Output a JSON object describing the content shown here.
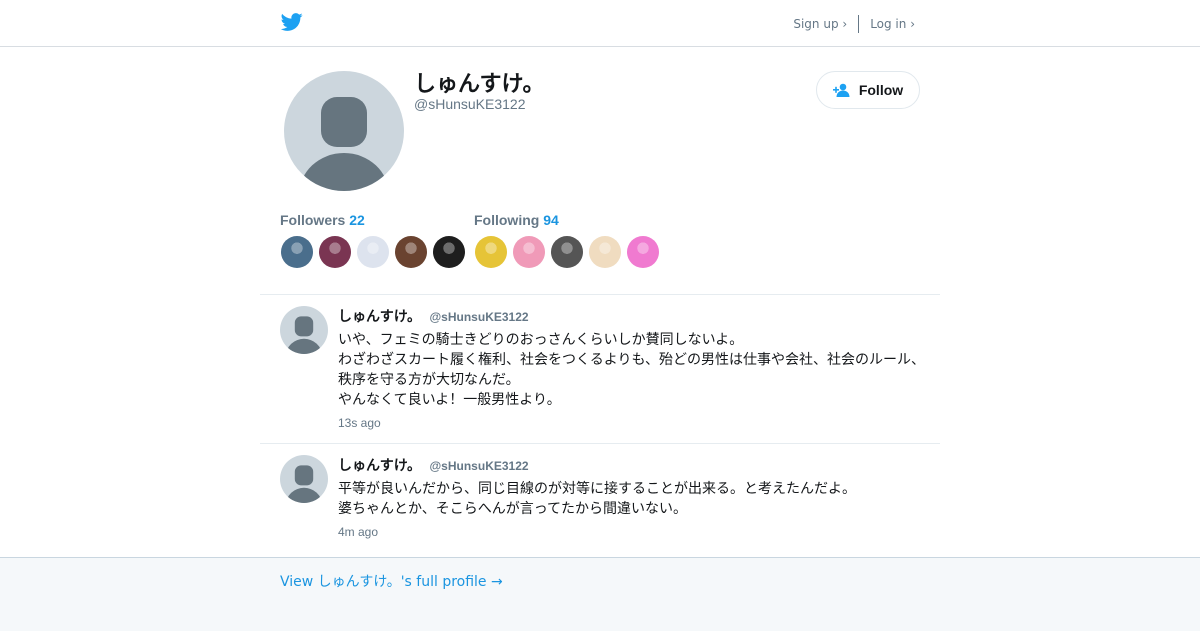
{
  "nav": {
    "signup_label": "Sign up ›",
    "login_label": "Log in ›"
  },
  "profile": {
    "name": "しゅんすけ。",
    "handle": "@sHunsuKE3122",
    "follow_label": "Follow"
  },
  "stats": {
    "followers_label": "Followers",
    "followers_count": "22",
    "following_label": "Following",
    "following_count": "94"
  },
  "followers_avatars": [
    "#4a6e8c",
    "#7a3552",
    "#dde3ee",
    "#6a4330",
    "#1e1e1e"
  ],
  "following_avatars": [
    "#e6c437",
    "#f09ab8",
    "#555555",
    "#f0dcc0",
    "#f07ad0"
  ],
  "tweets": [
    {
      "name": "しゅんすけ。",
      "handle": "@sHunsuKE3122",
      "lines": [
        "いや、フェミの騎士きどりのおっさんくらいしか賛同しないよ。",
        "わざわざスカート履く権利、社会をつくるよりも、殆どの男性は仕事や会社、社会のルール、",
        "秩序を守る方が大切なんだ。",
        "やんなくて良いよ！一般男性より。"
      ],
      "time": "13s ago"
    },
    {
      "name": "しゅんすけ。",
      "handle": "@sHunsuKE3122",
      "lines": [
        "平等が良いんだから、同じ目線のが対等に接することが出来る。と考えたんだよ。",
        "婆ちゃんとか、そこらへんが言ってたから間違いない。"
      ],
      "time": "4m ago"
    }
  ],
  "footer": {
    "full_profile_label": "View しゅんすけ。's full profile →"
  },
  "colors": {
    "accent": "#1b95e0",
    "twitter_blue": "#1da1f2",
    "muted": "#657786"
  },
  "icons": {
    "logo": "twitter-bird-icon",
    "follow": "add-person-icon",
    "default_avatar": "default-avatar-icon"
  }
}
